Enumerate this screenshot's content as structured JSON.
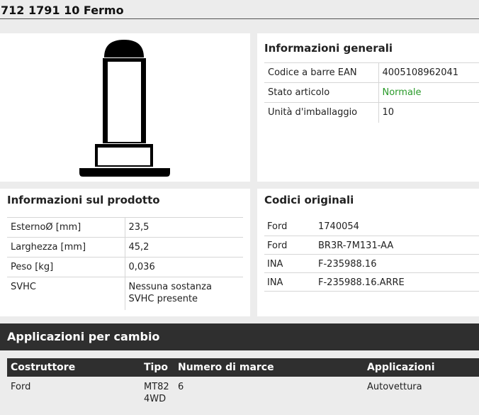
{
  "page": {
    "title": "712 1791 10 Fermo"
  },
  "general_info": {
    "heading": "Informazioni generali",
    "rows": [
      {
        "label": "Codice a barre EAN",
        "value": "4005108962041"
      },
      {
        "label": "Stato articolo",
        "value": "Normale"
      },
      {
        "label": "Unità d'imballaggio",
        "value": "10"
      }
    ],
    "status_color": "#2a9a2a"
  },
  "product_info": {
    "heading": "Informazioni sul prodotto",
    "rows": [
      {
        "label": "EsternoØ [mm]",
        "value": "23,5"
      },
      {
        "label": "Larghezza [mm]",
        "value": "45,2"
      },
      {
        "label": "Peso [kg]",
        "value": "0,036"
      },
      {
        "label": "SVHC",
        "value_lines": [
          "Nessuna sostanza",
          "SVHC presente"
        ]
      }
    ]
  },
  "original_codes": {
    "heading": "Codici originali",
    "rows": [
      {
        "maker": "Ford",
        "code": "1740054"
      },
      {
        "maker": "Ford",
        "code": "BR3R-7M131-AA"
      },
      {
        "maker": "INA",
        "code": "F-235988.16"
      },
      {
        "maker": "INA",
        "code": "F-235988.16.ARRE"
      }
    ]
  },
  "applications": {
    "heading": "Applicazioni per cambio",
    "columns": [
      "Costruttore",
      "Tipo",
      "Numero di marce",
      "Applicazioni"
    ],
    "rows": [
      {
        "maker": "Ford",
        "type_lines": [
          "MT82",
          "4WD"
        ],
        "gears": "6",
        "application": "Autovettura"
      }
    ]
  },
  "product_image": {
    "icon": "shift-fork-stop-drawing"
  },
  "colors": {
    "background": "#ececec",
    "panel": "#ffffff",
    "dark_bar": "#2f2f2f"
  }
}
